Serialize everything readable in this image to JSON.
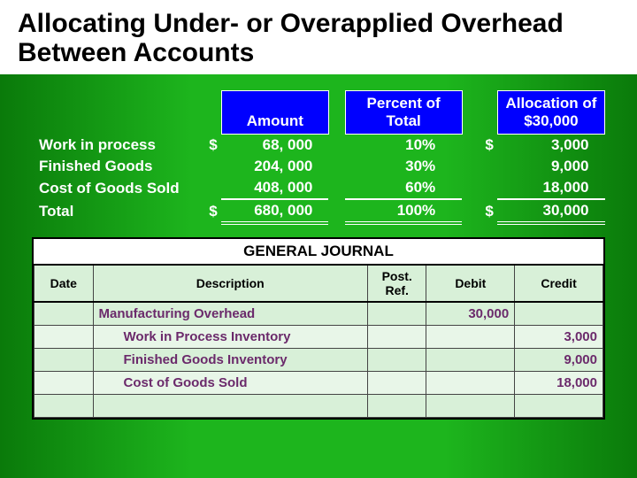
{
  "title": "Allocating Under- or Overapplied Overhead Between Accounts",
  "alloc": {
    "headers": {
      "amount": "Amount",
      "percent": "Percent of Total",
      "allocation": "Allocation of $30,000"
    },
    "rows": [
      {
        "label": "Work in process",
        "cur1": "$",
        "amount": "68, 000",
        "pct": "10%",
        "cur2": "$",
        "alloc": "3,000"
      },
      {
        "label": "Finished Goods",
        "cur1": "",
        "amount": "204, 000",
        "pct": "30%",
        "cur2": "",
        "alloc": "9,000"
      },
      {
        "label": "Cost of Goods Sold",
        "cur1": "",
        "amount": "408, 000",
        "pct": "60%",
        "cur2": "",
        "alloc": "18,000"
      }
    ],
    "total": {
      "label": "Total",
      "cur1": "$",
      "amount": "680, 000",
      "pct": "100%",
      "cur2": "$",
      "alloc": "30,000"
    }
  },
  "journal": {
    "title": "GENERAL JOURNAL",
    "headers": {
      "date": "Date",
      "desc": "Description",
      "ref": "Post. Ref.",
      "debit": "Debit",
      "credit": "Credit"
    },
    "entries": [
      {
        "desc": "Manufacturing Overhead",
        "indent": false,
        "debit": "30,000",
        "credit": ""
      },
      {
        "desc": "Work in Process Inventory",
        "indent": true,
        "debit": "",
        "credit": "3,000"
      },
      {
        "desc": "Finished Goods Inventory",
        "indent": true,
        "debit": "",
        "credit": "9,000"
      },
      {
        "desc": "Cost of Goods Sold",
        "indent": true,
        "debit": "",
        "credit": "18,000"
      },
      {
        "desc": "",
        "indent": false,
        "debit": "",
        "credit": ""
      }
    ]
  }
}
